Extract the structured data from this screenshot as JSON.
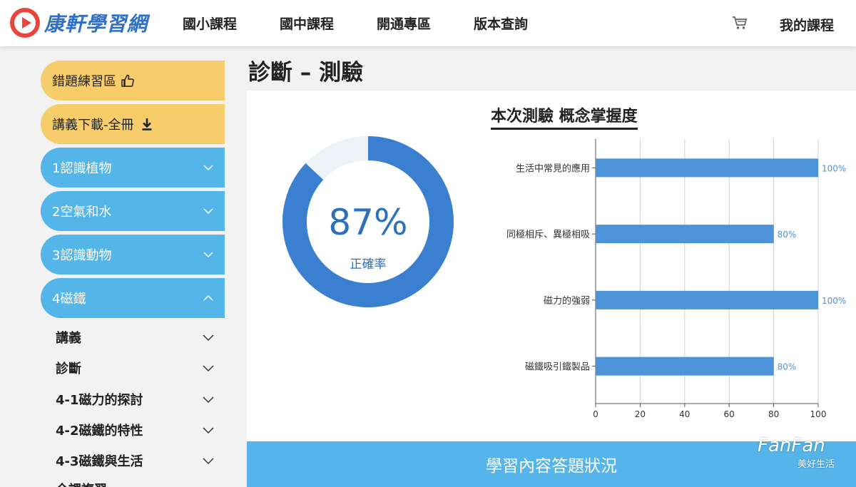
{
  "header": {
    "logo_text": "康軒學習網",
    "nav": [
      "國小課程",
      "國中課程",
      "開通專區",
      "版本查詢"
    ],
    "my_courses": "我的課程"
  },
  "sidebar": {
    "wrong_practice": "錯題練習區",
    "download": "講義下載-全冊",
    "units": [
      "1認識植物",
      "2空氣和水",
      "3認識動物",
      "4磁鐵"
    ],
    "sub_items": [
      "講義",
      "診斷",
      "4-1磁力的探討",
      "4-2磁鐵的特性",
      "4-3磁鐵與生活",
      "全課複習"
    ]
  },
  "main": {
    "page_title": "診斷 – 測驗",
    "card_title": "本次測驗 概念掌握度",
    "accuracy": "87%",
    "accuracy_label": "正確率",
    "bottom_banner": "學習內容答題狀況"
  },
  "watermark": {
    "main": "FanFan",
    "sub": "美好生活"
  },
  "colors": {
    "accent_blue": "#3a7fd0",
    "bar_blue": "#4d93d9",
    "sidebar_blue": "#54b5e9",
    "sidebar_yellow": "#f7cd6b",
    "banner_blue": "#55b4e9"
  },
  "chart_data": [
    {
      "type": "pie",
      "values": [
        87,
        13
      ],
      "labels": [
        "87%",
        ""
      ],
      "center_label": "正確率"
    },
    {
      "type": "bar",
      "orientation": "horizontal",
      "categories": [
        "生活中常見的應用",
        "同極相斥、異極相吸",
        "磁力的強弱",
        "磁鐵吸引鐵製品"
      ],
      "values": [
        100,
        80,
        100,
        80
      ],
      "data_labels": [
        "100%",
        "80%",
        "100%",
        "80%"
      ],
      "xticks": [
        "0",
        "20",
        "40",
        "60",
        "80",
        "100"
      ],
      "xlim": [
        0,
        100
      ],
      "grid": true,
      "title": "本次測驗 概念掌握度"
    }
  ]
}
